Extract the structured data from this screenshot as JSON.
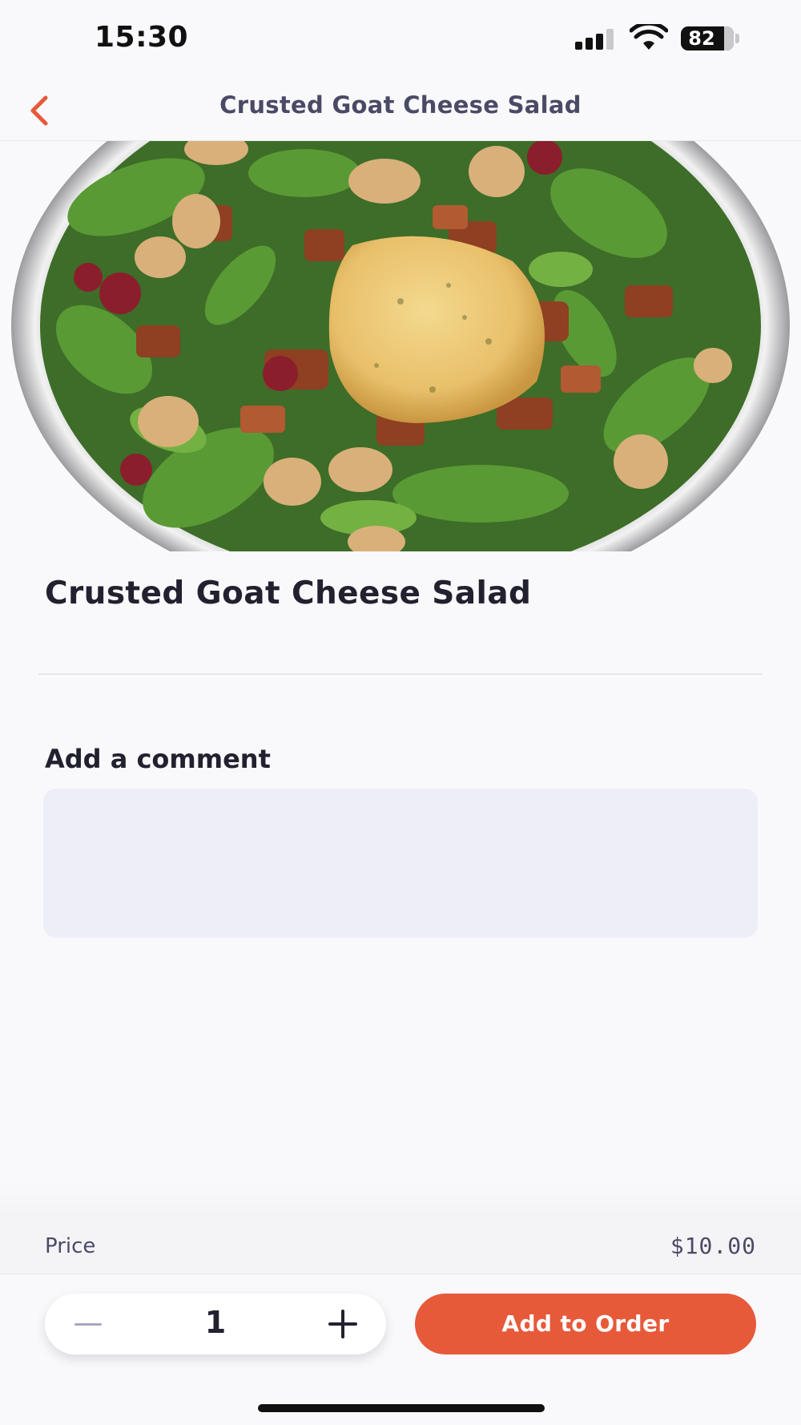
{
  "status_bar": {
    "time": "15:30",
    "battery": "82",
    "icons": [
      "cellular-signal-icon",
      "wifi-icon",
      "battery-icon"
    ]
  },
  "nav": {
    "title": "Crusted Goat Cheese Salad",
    "back_icon": "chevron-left-icon",
    "accent": "#e65a3a"
  },
  "hero": {
    "alt": "Crusted goat cheese salad"
  },
  "item": {
    "title": "Crusted Goat Cheese Salad"
  },
  "comment": {
    "label": "Add a comment",
    "value": "",
    "placeholder": ""
  },
  "price": {
    "label": "Price",
    "value": "$10.00"
  },
  "order": {
    "quantity": "1",
    "minus_icon": "minus-icon",
    "plus_icon": "plus-icon",
    "add_label": "Add to Order",
    "button_color": "#e65a3a"
  }
}
